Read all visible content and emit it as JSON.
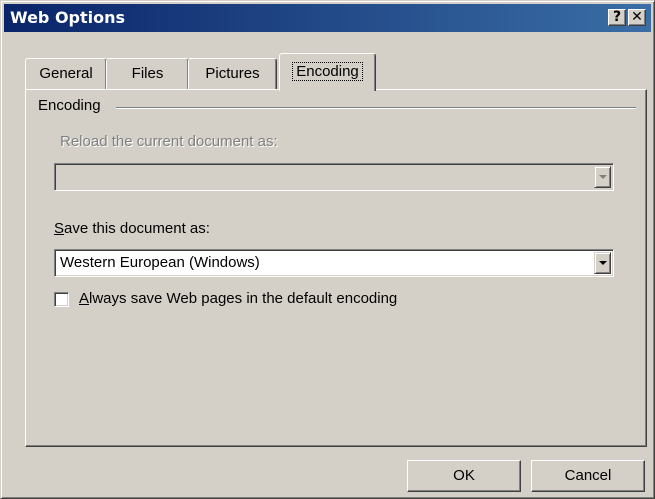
{
  "window": {
    "title": "Web Options",
    "help_button": "?",
    "close_button": "✕"
  },
  "tabs": [
    {
      "label": "General",
      "active": false
    },
    {
      "label": "Files",
      "active": false
    },
    {
      "label": "Pictures",
      "active": false
    },
    {
      "label": "Encoding",
      "active": true
    }
  ],
  "encoding": {
    "group_label": "Encoding",
    "reload_label": "Reload the current document as:",
    "reload_value": "",
    "save_label_mnemonic": "S",
    "save_label_rest": "ave this document as:",
    "save_value": "Western European (Windows)",
    "checkbox_mnemonic": "A",
    "checkbox_rest": "lways save Web pages in the default encoding",
    "checkbox_checked": false
  },
  "buttons": {
    "ok": "OK",
    "cancel": "Cancel"
  }
}
